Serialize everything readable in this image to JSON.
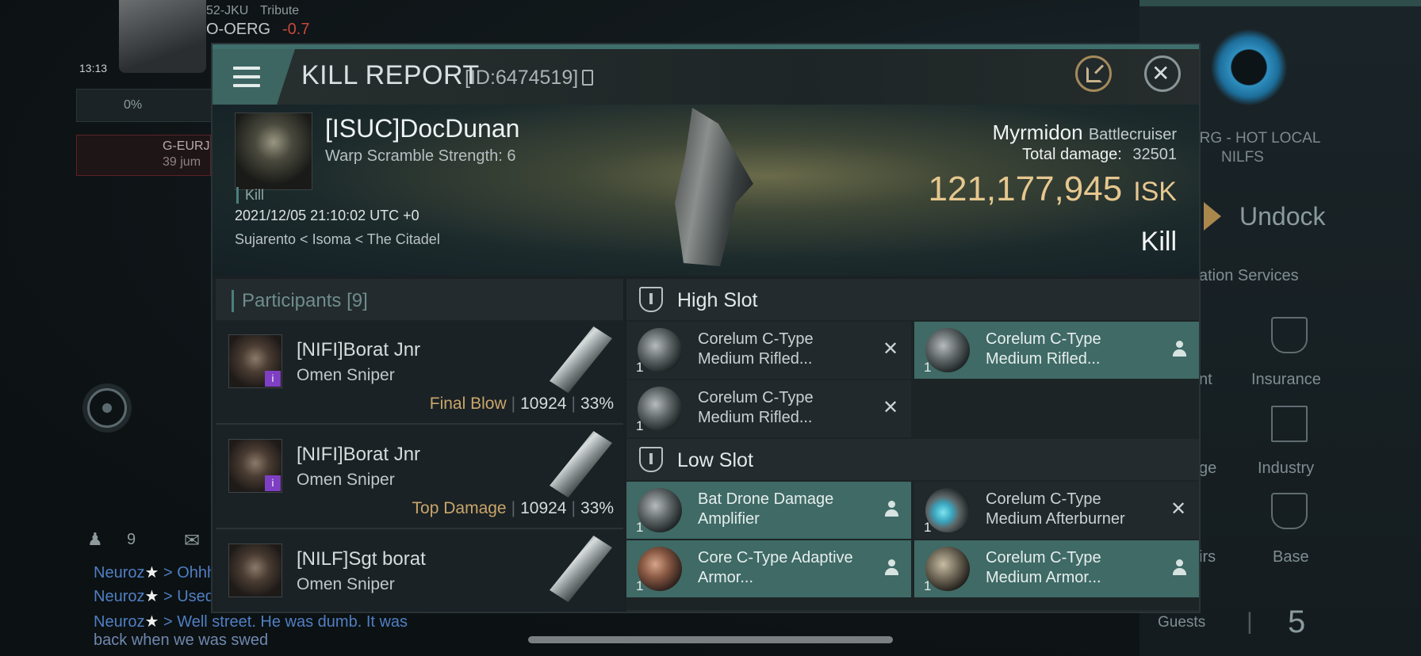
{
  "background": {
    "hud": {
      "system": "52-JKU",
      "tribute": "Tribute",
      "location": "O-OERG",
      "security": "-0.7",
      "time": "13:13",
      "cargo_pct": "0%",
      "route_destination": "G-EURJ",
      "route_jumps": "39 jum"
    },
    "chat": {
      "online_count": "9",
      "lines": [
        {
          "sender": "Neuroz",
          "text": " > Ohhh"
        },
        {
          "sender": "Neuroz",
          "text": " > Used"
        },
        {
          "sender": "Neuroz",
          "text": " > Well street. He was dumb. It was"
        }
      ],
      "continuation": "back when we was swed"
    },
    "station": {
      "name_line1": "ERG - HOT LOCAL",
      "name_line2": "NILFS",
      "undock": "Undock",
      "services_label": "ation Services",
      "service_items": [
        "nt",
        "Insurance",
        "ge",
        "Industry",
        "irs",
        "Base"
      ],
      "guests_label": "Guests",
      "guests_count": "5"
    }
  },
  "modal": {
    "title": "KILL REPORT",
    "id_text": "[ID:6474519]",
    "victim": {
      "name": "[ISUC]DocDunan",
      "subtitle": "Warp Scramble Strength: 6",
      "tag": "Kill",
      "datetime": "2021/12/05 21:10:02 UTC +0",
      "location": "Sujarento < Isoma < The Citadel"
    },
    "ship": {
      "name": "Myrmidon",
      "class": "Battlecruiser",
      "total_damage_label": "Total damage:",
      "total_damage": "32501",
      "isk_value": "121,177,945",
      "isk_unit": "ISK",
      "result": "Kill"
    },
    "participants": {
      "title": "Participants",
      "count": "[9]",
      "rows": [
        {
          "name": "[NIFI]Borat Jnr",
          "ship": "Omen Sniper",
          "tag": "Final Blow",
          "damage": "10924",
          "percent": "33%"
        },
        {
          "name": "[NIFI]Borat Jnr",
          "ship": "Omen Sniper",
          "tag": "Top Damage",
          "damage": "10924",
          "percent": "33%"
        },
        {
          "name": "[NILF]Sgt borat",
          "ship": "Omen Sniper",
          "tag": "",
          "damage": "",
          "percent": ""
        }
      ]
    },
    "slots": {
      "high_title": "High Slot",
      "low_title": "Low Slot",
      "high": [
        {
          "qty": "1",
          "name": "Corelum C-Type Medium Rifled...",
          "status": "destroyed"
        },
        {
          "qty": "1",
          "name": "Corelum C-Type Medium Rifled...",
          "status": "dropped"
        },
        {
          "qty": "1",
          "name": "Corelum C-Type Medium Rifled...",
          "status": "destroyed"
        }
      ],
      "low": [
        {
          "qty": "1",
          "name": "Bat Drone Damage Amplifier",
          "status": "dropped"
        },
        {
          "qty": "1",
          "name": "Corelum C-Type Medium Afterburner",
          "status": "destroyed"
        },
        {
          "qty": "1",
          "name": "Core C-Type Adaptive Armor...",
          "status": "dropped"
        },
        {
          "qty": "1",
          "name": "Corelum C-Type Medium Armor...",
          "status": "dropped"
        }
      ],
      "destroyed_glyph": "✕"
    }
  }
}
